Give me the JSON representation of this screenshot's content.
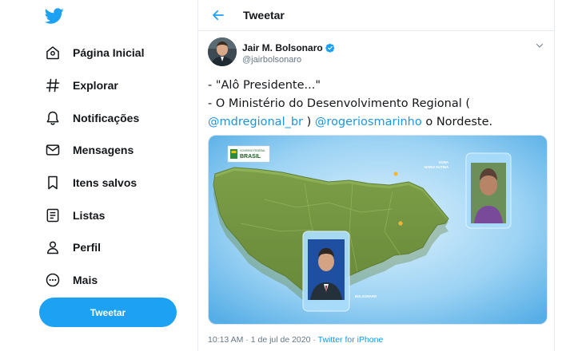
{
  "sidebar": {
    "logo_icon": "twitter-bird-icon",
    "items": [
      {
        "label": "Página Inicial",
        "icon": "home-icon"
      },
      {
        "label": "Explorar",
        "icon": "hashtag-icon"
      },
      {
        "label": "Notificações",
        "icon": "bell-icon"
      },
      {
        "label": "Mensagens",
        "icon": "envelope-icon"
      },
      {
        "label": "Itens salvos",
        "icon": "bookmark-icon"
      },
      {
        "label": "Listas",
        "icon": "list-icon"
      },
      {
        "label": "Perfil",
        "icon": "person-icon"
      },
      {
        "label": "Mais",
        "icon": "more-icon"
      }
    ],
    "tweet_button": "Tweetar"
  },
  "header": {
    "title": "Tweetar",
    "back_icon": "arrow-left-icon"
  },
  "tweet": {
    "author_name": "Jair M. Bolsonaro",
    "handle": "@jairbolsonaro",
    "verified_icon": "verified-badge-icon",
    "line1": "- \"Alô Presidente...\"",
    "line2": "- O Ministério do Desenvolvimento Regional (",
    "mention1": "@mdregional_br",
    "sep": " ) ",
    "mention2": "@rogeriosmarinho",
    "tail": " o Nordeste.",
    "media": {
      "brand_top": "GOVERNO FEDERAL",
      "brand": "BRASIL",
      "card_right_line1": "DONA",
      "card_right_line2": "MARIA EUTINA",
      "card_left_label": "BOLSONARO"
    },
    "time": "10:13 AM",
    "date": "1 de jul de 2020",
    "dot": " · ",
    "source": "Twitter for iPhone"
  },
  "colors": {
    "accent": "#1da1f2",
    "link": "#1b95e0",
    "text": "#14171a",
    "muted": "#657786"
  }
}
